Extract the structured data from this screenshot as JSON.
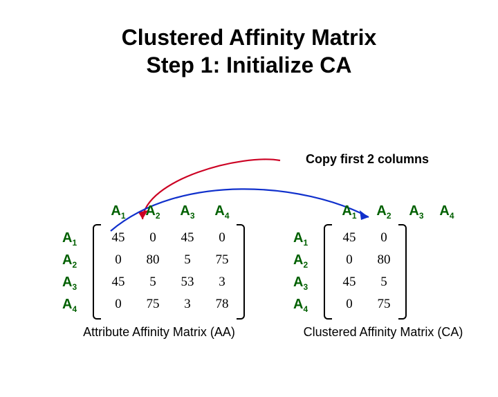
{
  "title_line1": "Clustered Affinity Matrix",
  "title_line2": "Step 1:  Initialize CA",
  "annotation": "Copy first 2 columns",
  "attr_labels": [
    "A1",
    "A2",
    "A3",
    "A4"
  ],
  "aa": {
    "caption": "Attribute Affinity Matrix (AA)",
    "rows": [
      [
        45,
        0,
        45,
        0
      ],
      [
        0,
        80,
        5,
        75
      ],
      [
        45,
        5,
        53,
        3
      ],
      [
        0,
        75,
        3,
        78
      ]
    ]
  },
  "ca": {
    "caption": "Clustered Affinity Matrix (CA)",
    "rows": [
      [
        45,
        0
      ],
      [
        0,
        80
      ],
      [
        45,
        5
      ],
      [
        0,
        75
      ]
    ],
    "ncols_visible": 2
  }
}
